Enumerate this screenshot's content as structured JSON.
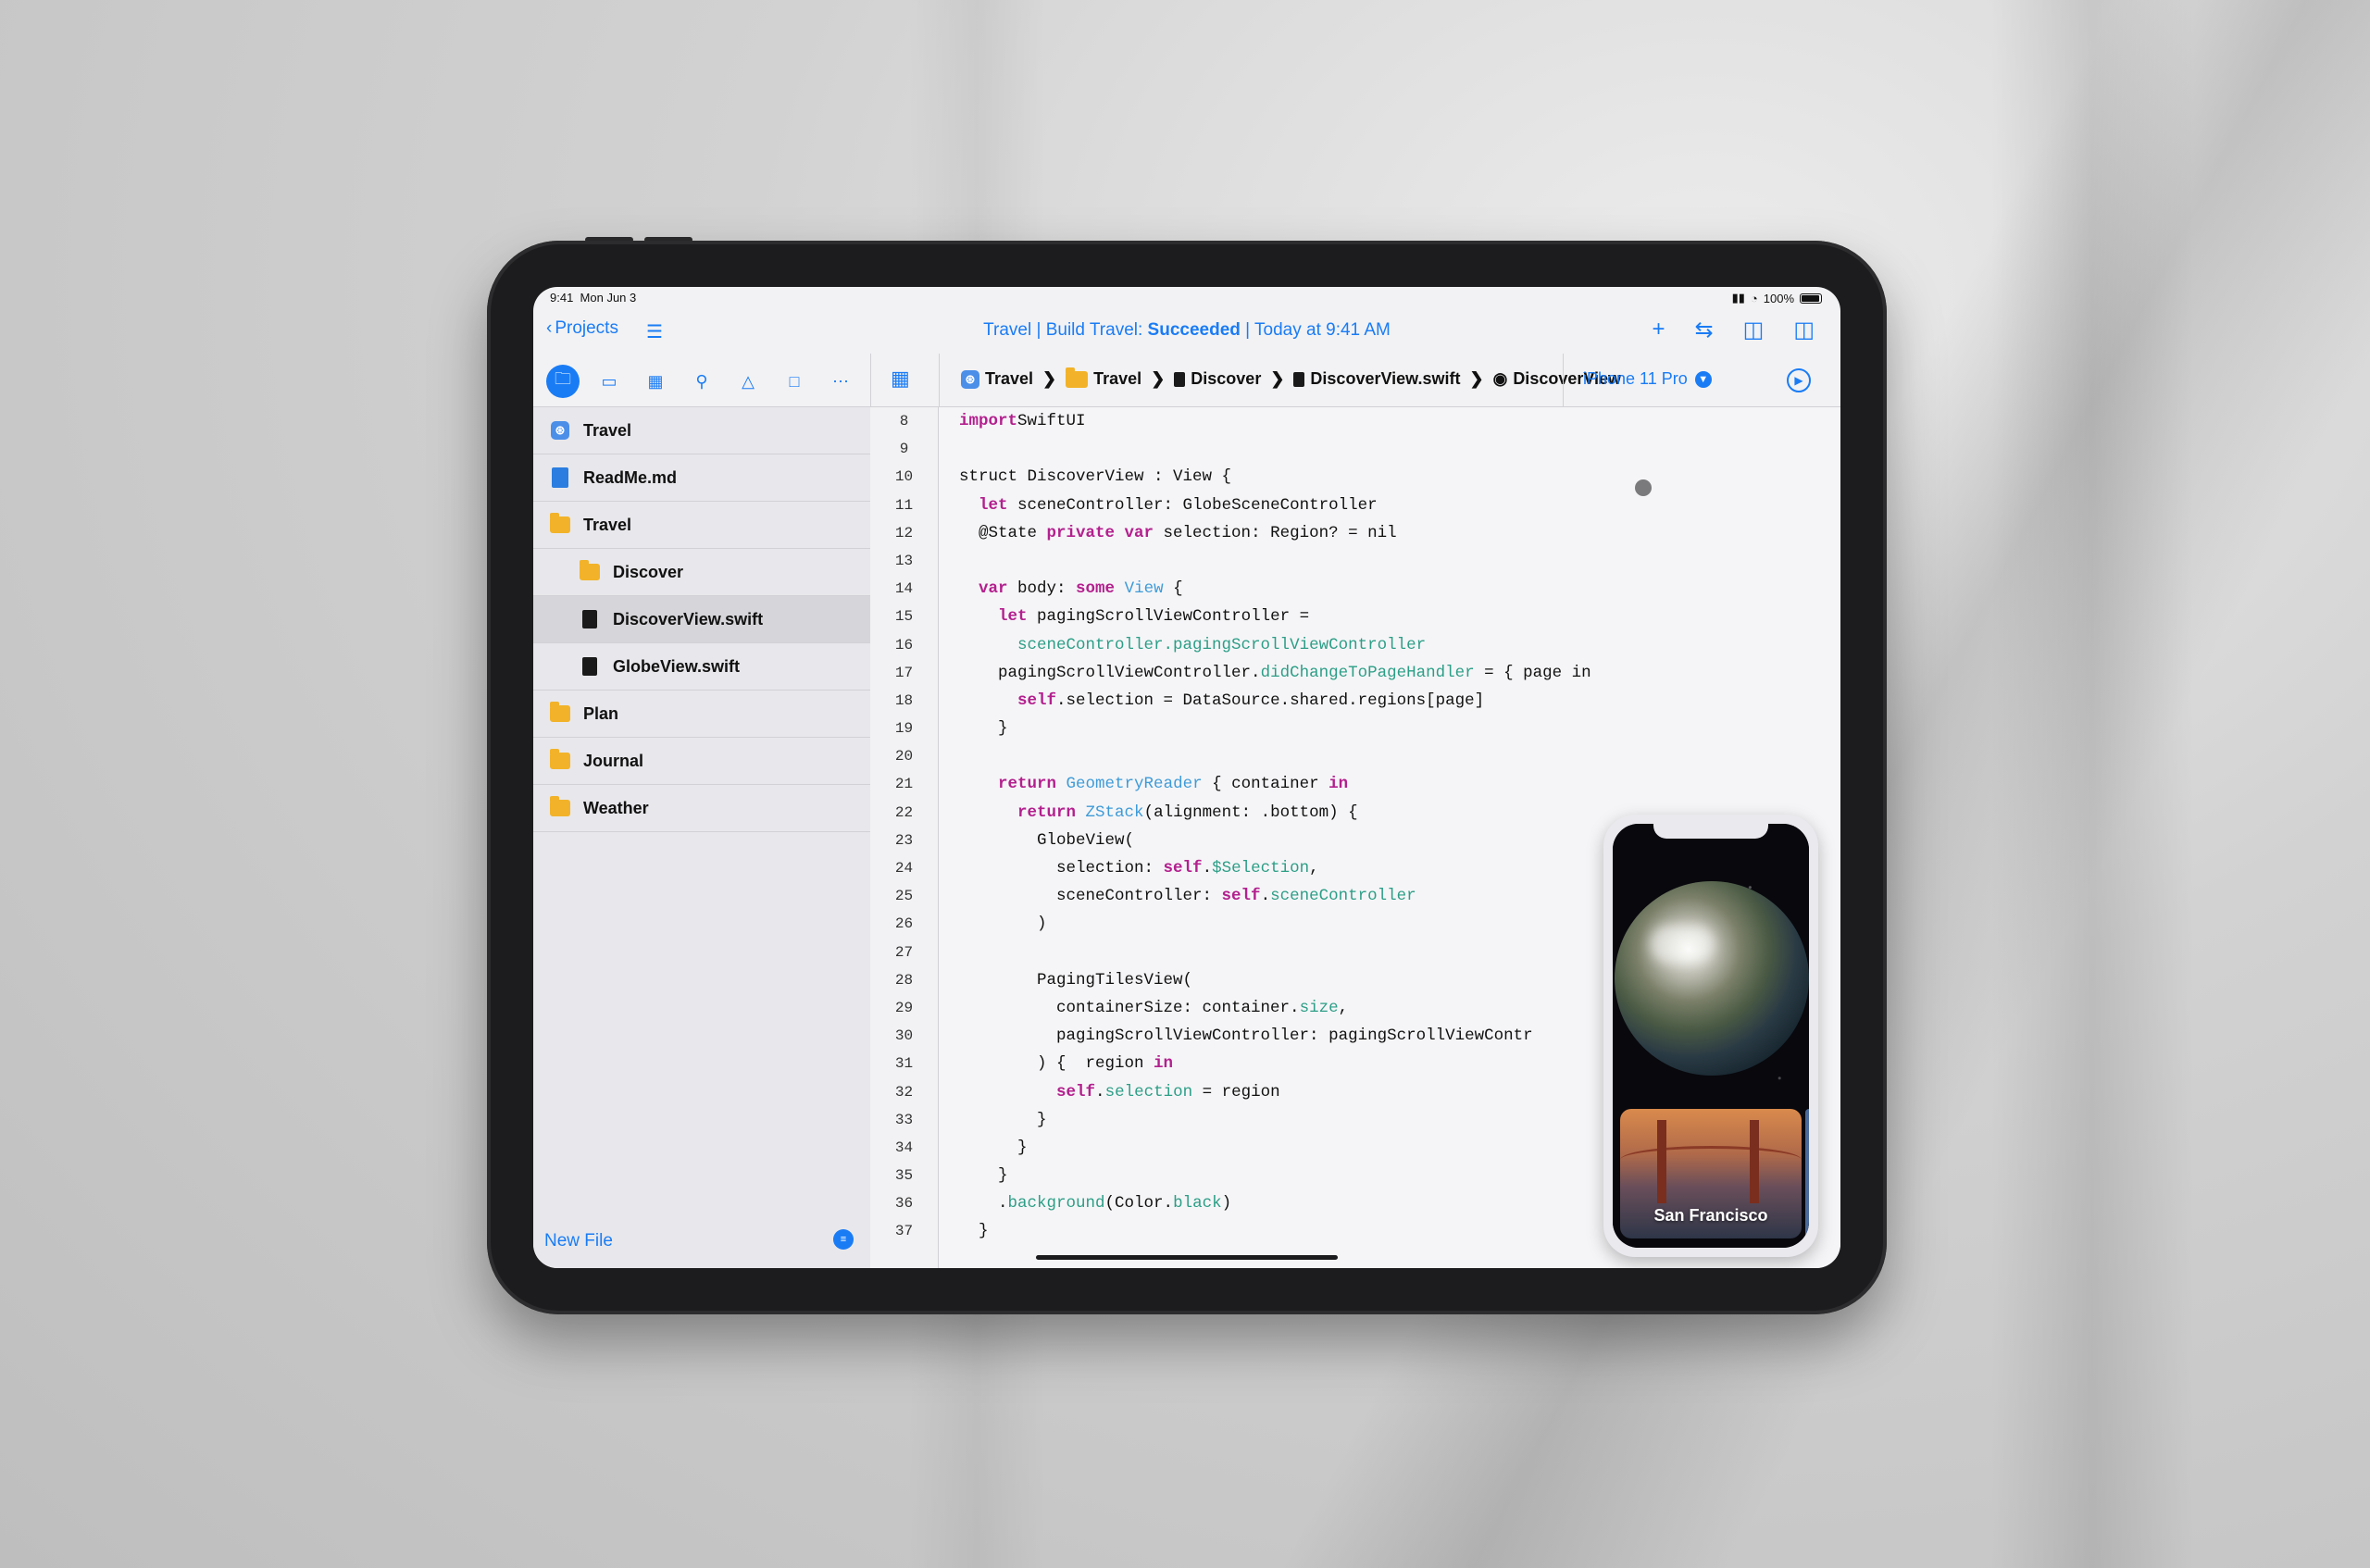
{
  "status_bar": {
    "time": "9:41",
    "date": "Mon Jun 3",
    "battery": "100%"
  },
  "title_bar": {
    "back_label": "Projects",
    "build_prefix": "Travel | Build Travel: ",
    "build_result": "Succeeded",
    "build_suffix": " | Today at 9:41 AM"
  },
  "icons": {
    "navigator": [
      "folder-icon",
      "cube-icon",
      "grid-icon",
      "search-icon",
      "warning-icon",
      "comment-icon",
      "more-icon"
    ],
    "title_actions": [
      "add-icon",
      "swap-icon",
      "sidebar-left-icon",
      "sidebar-right-icon"
    ]
  },
  "breadcrumb": [
    "Travel",
    "Travel",
    "Discover",
    "DiscoverView.swift",
    "DiscoverView"
  ],
  "run_destination": "iPhone 11 Pro",
  "files": [
    {
      "name": "Travel",
      "icon": "app",
      "indent": 0,
      "selected": false
    },
    {
      "name": "ReadMe.md",
      "icon": "doc-blue",
      "indent": 0,
      "selected": false
    },
    {
      "name": "Travel",
      "icon": "folder",
      "indent": 0,
      "selected": false
    },
    {
      "name": "Discover",
      "icon": "folder",
      "indent": 1,
      "selected": false
    },
    {
      "name": "DiscoverView.swift",
      "icon": "doc-black",
      "indent": 1,
      "selected": true
    },
    {
      "name": "GlobeView.swift",
      "icon": "doc-black",
      "indent": 1,
      "selected": false
    },
    {
      "name": "Plan",
      "icon": "folder",
      "indent": 0,
      "selected": false
    },
    {
      "name": "Journal",
      "icon": "folder",
      "indent": 0,
      "selected": false
    },
    {
      "name": "Weather",
      "icon": "folder",
      "indent": 0,
      "selected": false
    }
  ],
  "sidebar_footer": {
    "new_file": "New File"
  },
  "code": {
    "line_numbers": [
      "8",
      "9",
      "10",
      "11",
      "12",
      "13",
      "14",
      "15",
      "16",
      "17",
      "18",
      "19",
      "20",
      "21",
      "22",
      "23",
      "24",
      "25",
      "26",
      "27",
      "28",
      "29",
      "30",
      "31",
      "32",
      "33",
      "34",
      "35",
      "36",
      "37"
    ],
    "lines": [
      [
        [
          "kw",
          "import"
        ],
        [
          "",
          "SwiftUI"
        ]
      ],
      [],
      [
        [
          "",
          "struct DiscoverView : View {"
        ]
      ],
      [
        [
          "",
          "  "
        ],
        [
          "kw",
          "let"
        ],
        [
          "",
          " sceneController: GlobeSceneController"
        ]
      ],
      [
        [
          "",
          "  @State "
        ],
        [
          "kw",
          "private var"
        ],
        [
          "",
          " selection: Region? = nil"
        ]
      ],
      [],
      [
        [
          "",
          "  "
        ],
        [
          "kw",
          "var"
        ],
        [
          "",
          " body: "
        ],
        [
          "kw",
          "some"
        ],
        [
          "",
          " "
        ],
        [
          "ty",
          "View"
        ],
        [
          "",
          " {"
        ]
      ],
      [
        [
          "",
          "    "
        ],
        [
          "kw",
          "let"
        ],
        [
          "",
          " pagingScrollViewController ="
        ]
      ],
      [
        [
          "",
          "      "
        ],
        [
          "fn",
          "sceneController.pagingScrollViewController"
        ]
      ],
      [
        [
          "",
          "    pagingScrollViewController."
        ],
        [
          "fn",
          "didChangeToPageHandler"
        ],
        [
          "",
          " = { page in"
        ]
      ],
      [
        [
          "",
          "      "
        ],
        [
          "kw",
          "self"
        ],
        [
          "",
          ".selection = DataSource.shared.regions[page]"
        ]
      ],
      [
        [
          "",
          "    }"
        ]
      ],
      [],
      [
        [
          "",
          "    "
        ],
        [
          "kw",
          "return"
        ],
        [
          "",
          " "
        ],
        [
          "ty",
          "GeometryReader"
        ],
        [
          "",
          " { container "
        ],
        [
          "kw",
          "in"
        ]
      ],
      [
        [
          "",
          "      "
        ],
        [
          "kw",
          "return"
        ],
        [
          "",
          " "
        ],
        [
          "ty",
          "ZStack"
        ],
        [
          "",
          "(alignment: .bottom) {"
        ]
      ],
      [
        [
          "",
          "        GlobeView("
        ]
      ],
      [
        [
          "",
          "          selection: "
        ],
        [
          "kw",
          "self"
        ],
        [
          "",
          "."
        ],
        [
          "fn",
          "$Selection"
        ],
        [
          "",
          ","
        ]
      ],
      [
        [
          "",
          "          sceneController: "
        ],
        [
          "kw",
          "self"
        ],
        [
          "",
          "."
        ],
        [
          "fn",
          "sceneController"
        ]
      ],
      [
        [
          "",
          "        )"
        ]
      ],
      [],
      [
        [
          "",
          "        PagingTilesView("
        ]
      ],
      [
        [
          "",
          "          containerSize: container."
        ],
        [
          "fn",
          "size"
        ],
        [
          "",
          ","
        ]
      ],
      [
        [
          "",
          "          pagingScrollViewController: pagingScrollViewContr"
        ]
      ],
      [
        [
          "",
          "        ) {  region "
        ],
        [
          "kw",
          "in"
        ]
      ],
      [
        [
          "",
          "          "
        ],
        [
          "kw",
          "self"
        ],
        [
          "",
          "."
        ],
        [
          "fn",
          "selection"
        ],
        [
          "",
          " = region"
        ]
      ],
      [
        [
          "",
          "        }"
        ]
      ],
      [
        [
          "",
          "      }"
        ]
      ],
      [
        [
          "",
          "    }"
        ]
      ],
      [
        [
          "",
          "    ."
        ],
        [
          "fn",
          "background"
        ],
        [
          "",
          "(Color."
        ],
        [
          "fn",
          "black"
        ],
        [
          "",
          ")"
        ]
      ],
      [
        [
          "",
          "  }"
        ]
      ]
    ]
  },
  "preview": {
    "card_label": "San Francisco"
  },
  "colors": {
    "accent": "#1a7cf5",
    "keyword": "#b3208e",
    "type": "#3e9bd8",
    "function": "#2c9e86",
    "folder": "#f2b32a"
  }
}
